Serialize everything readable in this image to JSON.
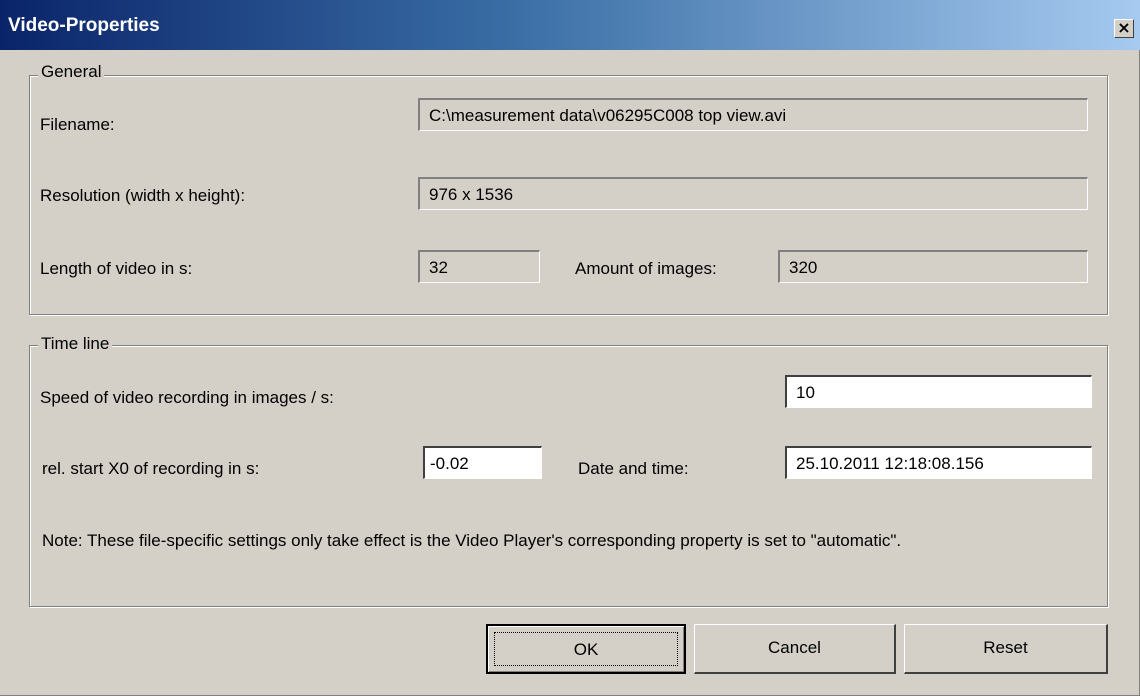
{
  "window": {
    "title": "Video-Properties",
    "close_glyph": "×"
  },
  "general": {
    "legend": "General",
    "filename_label": "Filename:",
    "filename_value": "C:\\measurement data\\v06295C008 top view.avi",
    "resolution_label": "Resolution (width x height):",
    "resolution_value": "976 x 1536",
    "length_label": "Length of video in s:",
    "length_value": "32",
    "images_label": "Amount of images:",
    "images_value": "320"
  },
  "timeline": {
    "legend": "Time line",
    "speed_label": "Speed of video recording in images / s:",
    "speed_value": "10",
    "start_label": "rel. start X0 of recording in s:",
    "start_value": "-0.02",
    "datetime_label": "Date and time:",
    "datetime_value": "25.10.2011 12:18:08.156",
    "note": "Note: These file-specific settings only take effect is the Video Player's corresponding property is set to \"automatic\"."
  },
  "buttons": {
    "ok": "OK",
    "cancel": "Cancel",
    "reset": "Reset"
  },
  "colors": {
    "dialog_bg": "#d4d0c8",
    "title_start": "#0a246a",
    "title_end": "#a6caf0"
  }
}
